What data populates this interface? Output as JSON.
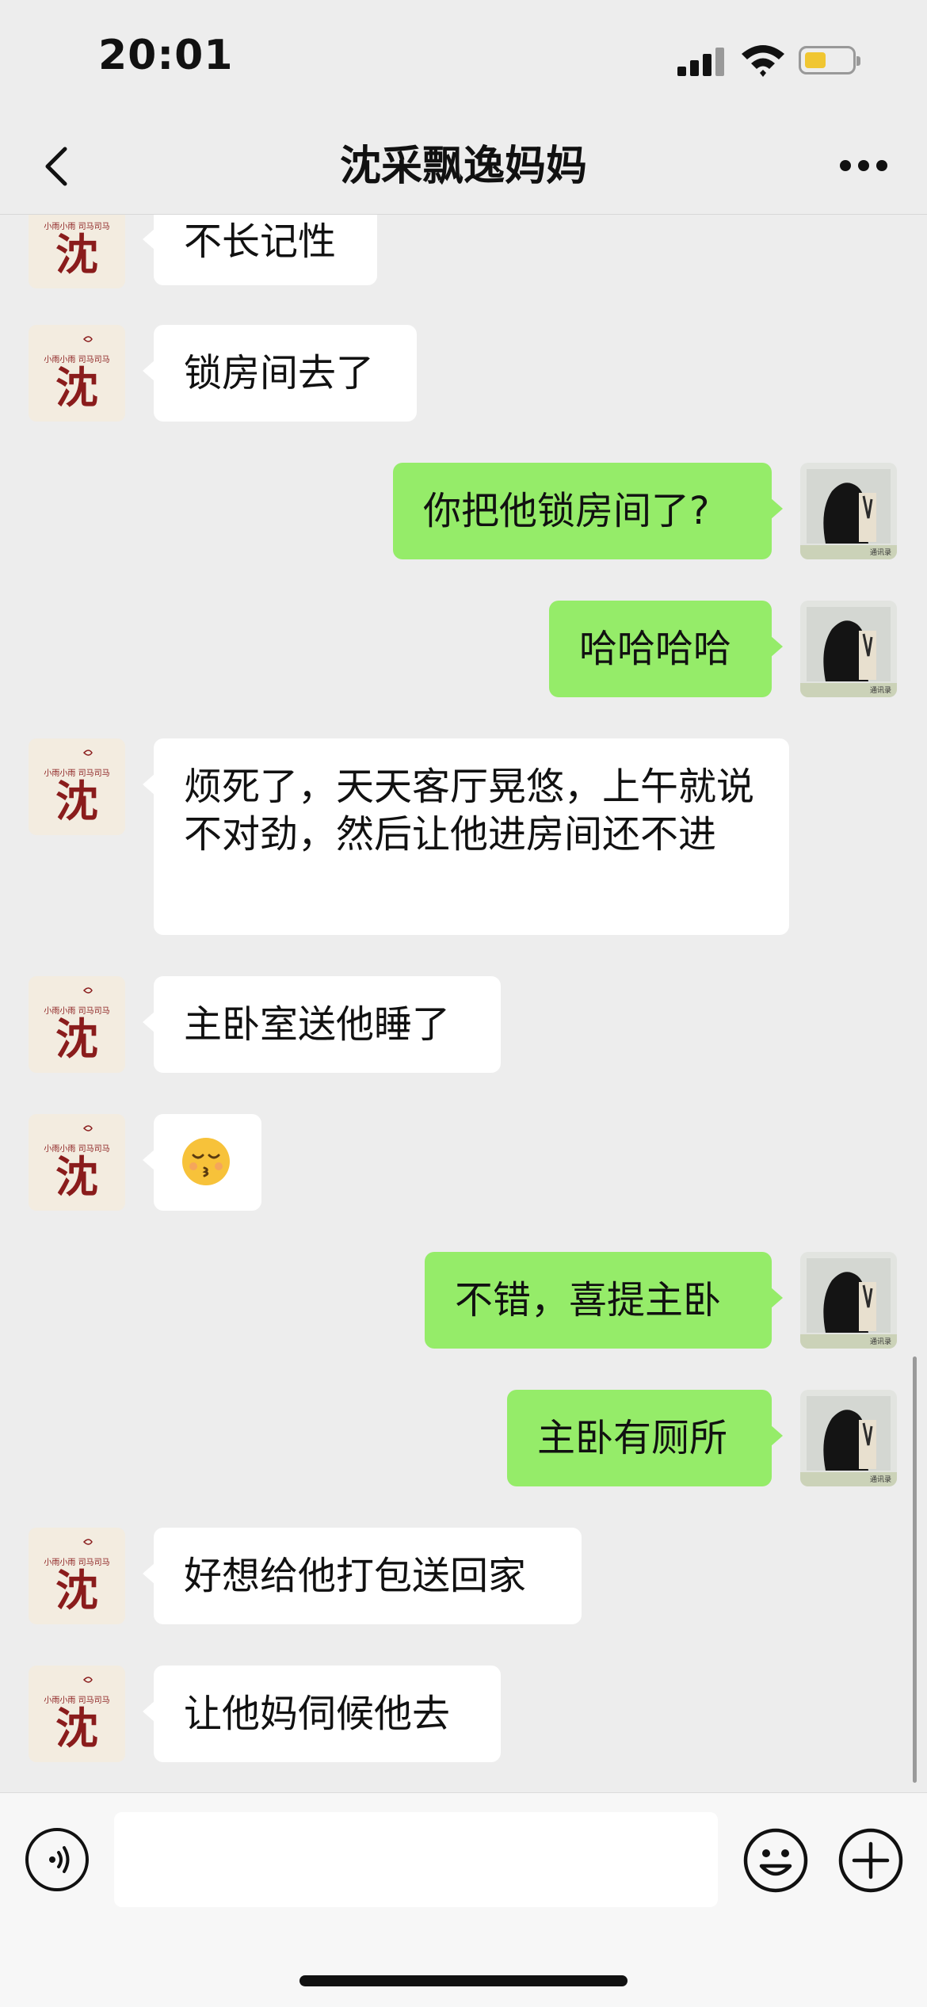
{
  "status": {
    "time": "20:01"
  },
  "header": {
    "title": "沈采飘逸妈妈"
  },
  "messages": [
    {
      "side": "in",
      "text": "不长记性"
    },
    {
      "side": "in",
      "text": "锁房间去了"
    },
    {
      "side": "out",
      "text": "你把他锁房间了?"
    },
    {
      "side": "out",
      "text": "哈哈哈哈"
    },
    {
      "side": "in",
      "text": "烦死了，天天客厅晃悠，上午就说不对劲，然后让他进房间还不进"
    },
    {
      "side": "in",
      "text": "主卧室送他睡了"
    },
    {
      "side": "in",
      "text": "",
      "emoji": "kissing-closed-eyes-emoji"
    },
    {
      "side": "out",
      "text": "不错，喜提主卧"
    },
    {
      "side": "out",
      "text": "主卧有厕所"
    },
    {
      "side": "in",
      "text": "好想给他打包送回家"
    },
    {
      "side": "in",
      "text": "让他妈伺候他去"
    }
  ],
  "avatars": {
    "contact": "沈",
    "self_caption": "通讯录"
  },
  "colors": {
    "background": "#ededed",
    "outgoing": "#95ec69",
    "incoming": "#ffffff",
    "battery": "#f0c632"
  },
  "icons": [
    "back-icon",
    "more-icon",
    "voice-icon",
    "emoji-icon",
    "plus-icon"
  ]
}
